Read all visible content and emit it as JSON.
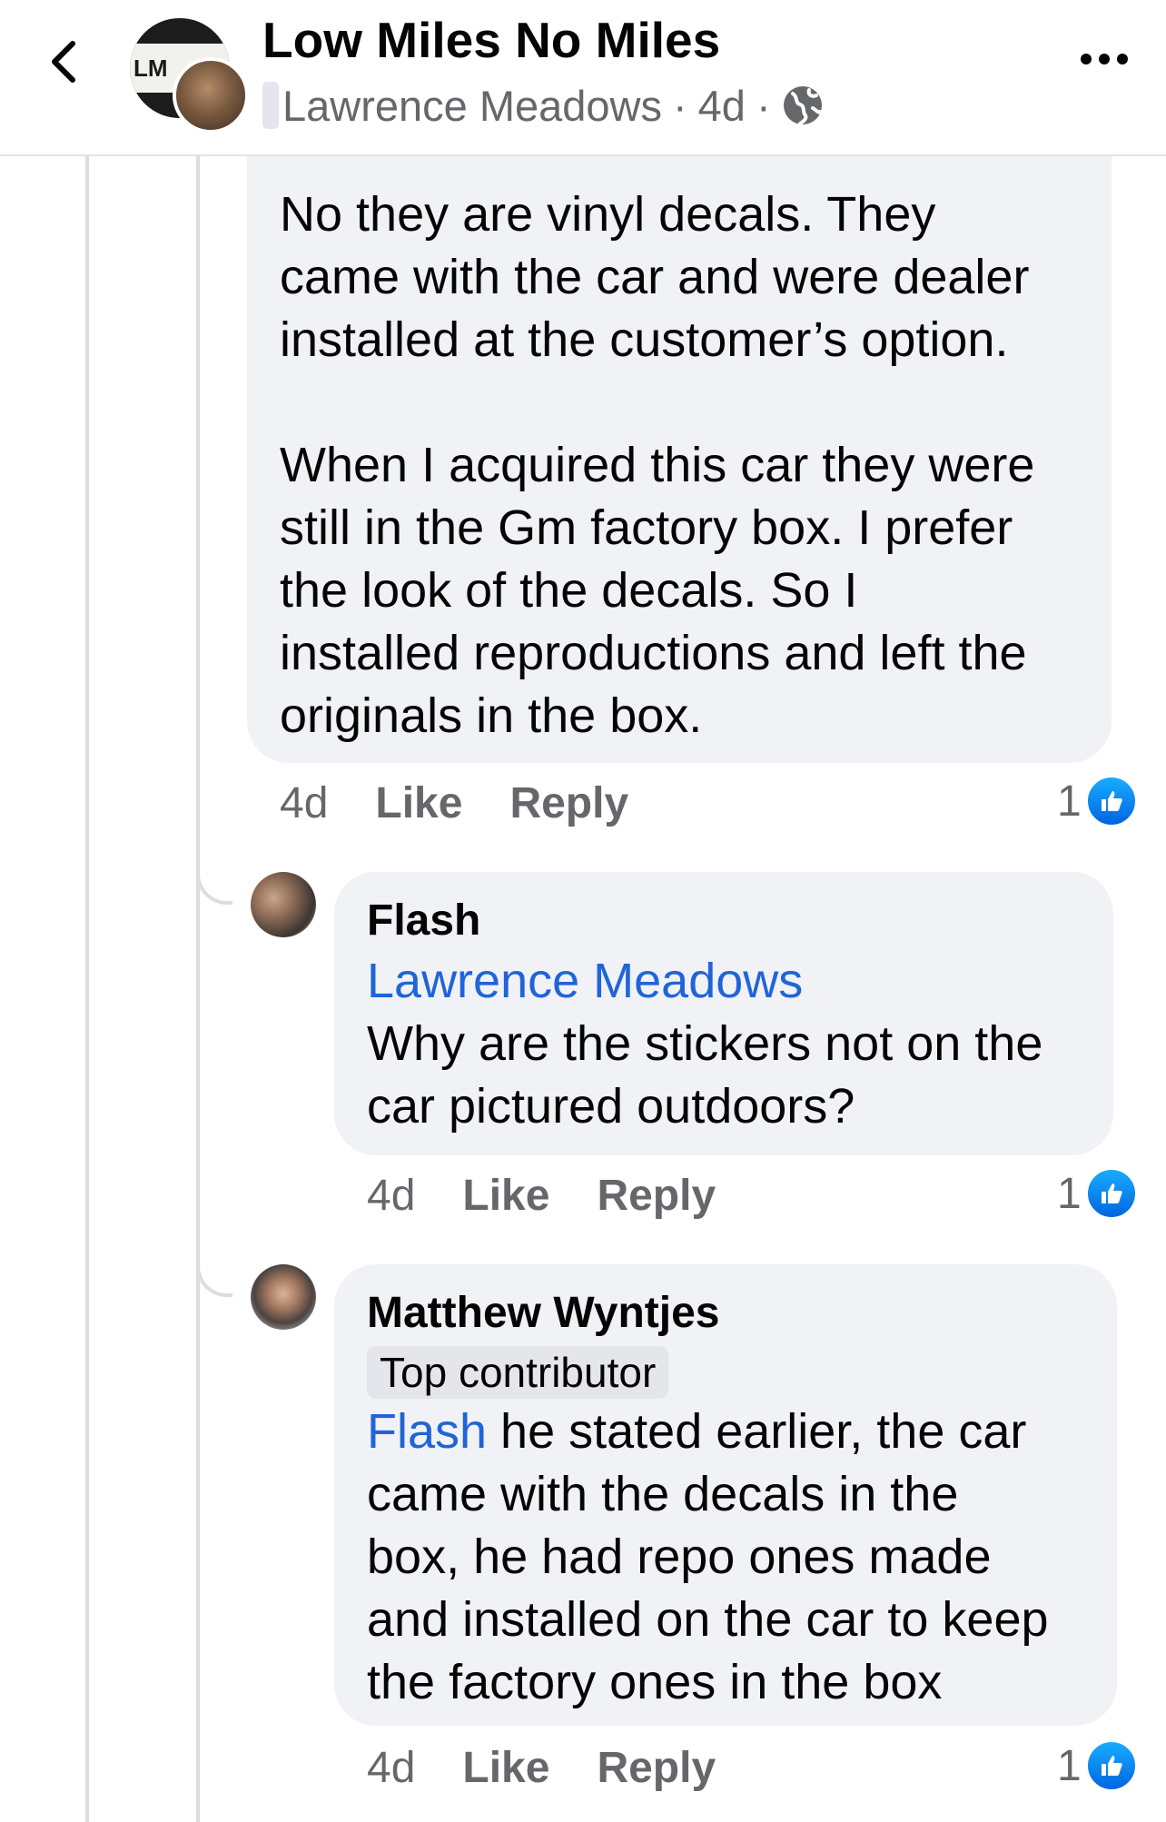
{
  "header": {
    "group_name": "Low Miles No Miles",
    "author": "Lawrence Meadows",
    "time": "4d",
    "separator": "·",
    "group_avatar_text": "LM"
  },
  "comments": [
    {
      "body": "No they are vinyl decals. They\ncame with the car and were dealer\ninstalled at the customer’s option.\n\nWhen I acquired this car they were\nstill in the Gm factory box. I prefer\nthe look of the decals. So  I\ninstalled reproductions and left the\noriginals in the box.",
      "time": "4d",
      "like_label": "Like",
      "reply_label": "Reply",
      "reaction_count": "1"
    },
    {
      "author": "Flash",
      "mention": "Lawrence Meadows",
      "body": "Why are the stickers not on the\ncar pictured outdoors?",
      "time": "4d",
      "like_label": "Like",
      "reply_label": "Reply",
      "reaction_count": "1"
    },
    {
      "author": "Matthew Wyntjes",
      "badge": "Top contributor",
      "mention": "Flash",
      "body": " he stated earlier, the car\ncame with the decals in the\nbox, he had repo ones made\nand installed on the car to keep\nthe factory ones in the box",
      "time": "4d",
      "like_label": "Like",
      "reply_label": "Reply",
      "reaction_count": "1"
    }
  ],
  "colors": {
    "bubble": "#f0f2f5",
    "mention": "#2064d8",
    "secondary_text": "#65676b",
    "like_blue": "#0866ff"
  }
}
